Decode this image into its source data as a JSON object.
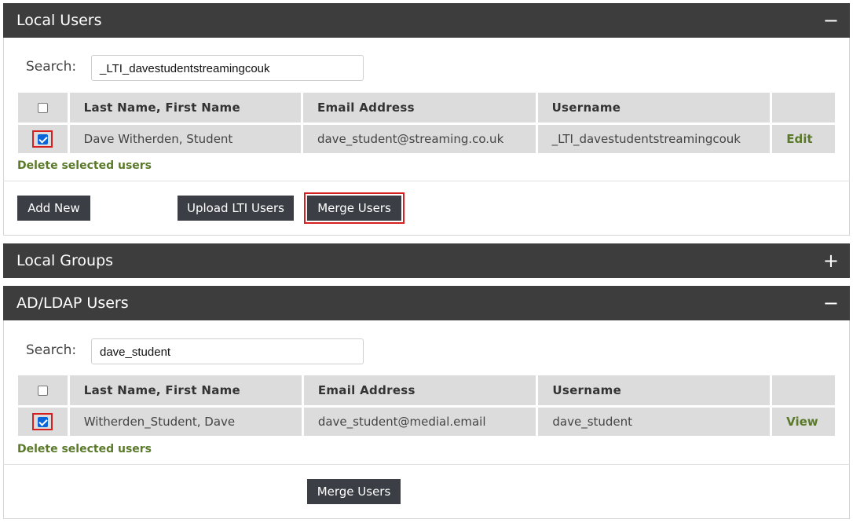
{
  "local_users": {
    "title": "Local Users",
    "toggle": "−",
    "search_label": "Search:",
    "search_value": "_LTI_davestudentstreamingcouk",
    "columns": [
      "Last Name, First Name",
      "Email Address",
      "Username"
    ],
    "rows": [
      {
        "name": "Dave Witherden, Student",
        "email": "dave_student@streaming.co.uk",
        "username": "_LTI_davestudentstreamingcouk",
        "action": "Edit",
        "checked": true
      }
    ],
    "delete_link": "Delete selected users",
    "buttons": {
      "add_new": "Add New",
      "upload_lti": "Upload LTI Users",
      "merge": "Merge Users"
    }
  },
  "local_groups": {
    "title": "Local Groups",
    "toggle": "+"
  },
  "ad_ldap_users": {
    "title": "AD/LDAP Users",
    "toggle": "−",
    "search_label": "Search:",
    "search_value": "dave_student",
    "columns": [
      "Last Name, First Name",
      "Email Address",
      "Username"
    ],
    "rows": [
      {
        "name": "Witherden_Student, Dave",
        "email": "dave_student@medial.email",
        "username": "dave_student",
        "action": "View",
        "checked": true
      }
    ],
    "delete_link": "Delete selected users",
    "buttons": {
      "merge": "Merge Users"
    }
  },
  "colors": {
    "header_bg": "#3d3d3d",
    "link_green": "#5a7a2a",
    "highlight_red": "#d62020",
    "checkbox_blue": "#0a66d8"
  }
}
